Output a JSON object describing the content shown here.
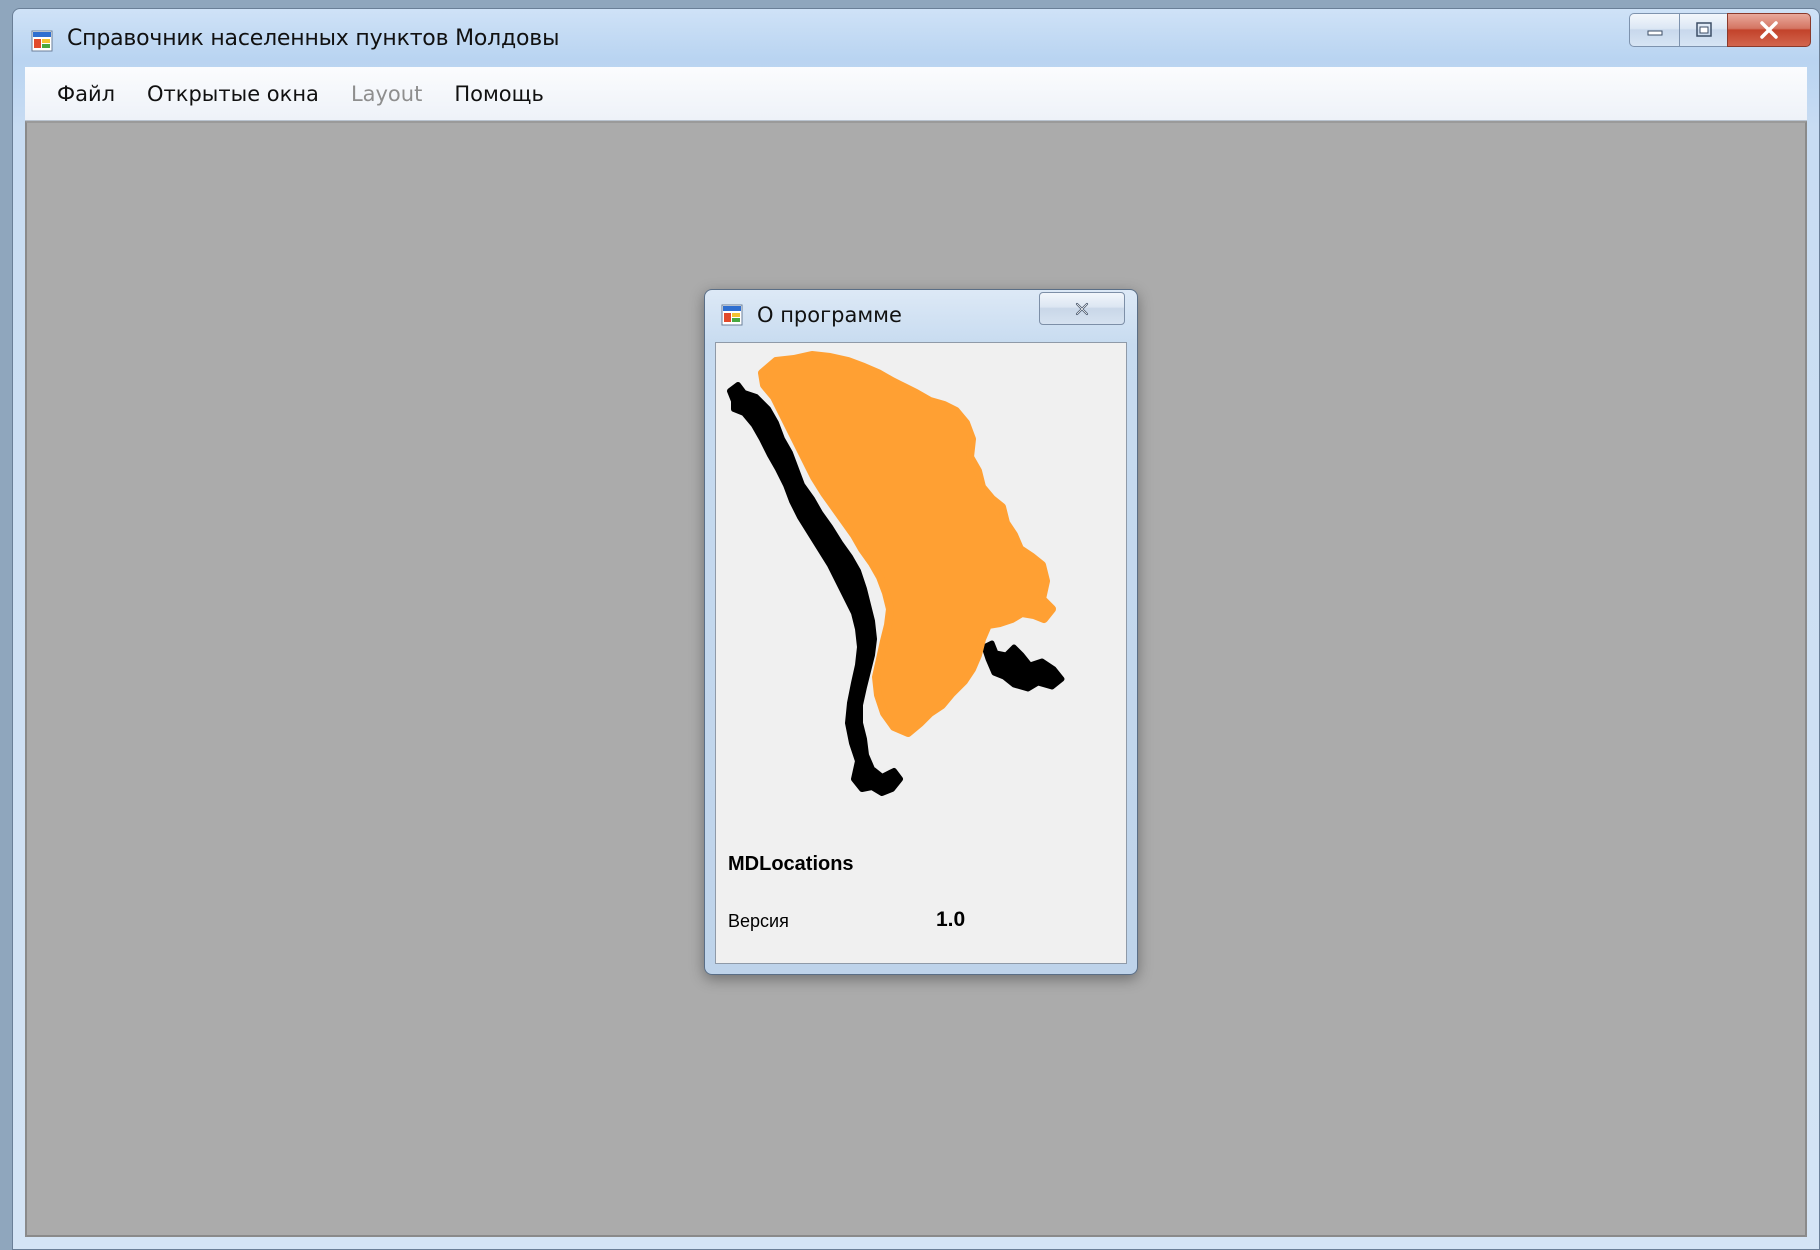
{
  "window": {
    "title": "Справочник населенных пунктов Молдовы"
  },
  "menu": {
    "items": [
      {
        "label": "Файл",
        "enabled": true
      },
      {
        "label": "Открытые окна",
        "enabled": true
      },
      {
        "label": "Layout",
        "enabled": false
      },
      {
        "label": "Помощь",
        "enabled": true
      }
    ]
  },
  "about_dialog": {
    "title": "О программе",
    "product_name": "MDLocations",
    "version_label": "Версия",
    "version_value": "1.0"
  },
  "colors": {
    "mdi_background": "#ababab",
    "map_fill": "#ffa033",
    "river_fill": "#000000"
  },
  "icons": [
    "app-icon",
    "minimize-icon",
    "maximize-icon",
    "close-icon",
    "moldova-map-image"
  ]
}
